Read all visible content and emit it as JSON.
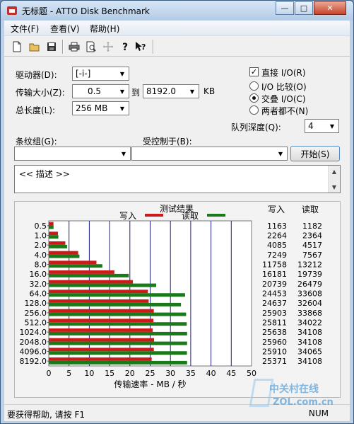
{
  "window": {
    "title": "无标题 - ATTO Disk Benchmark",
    "min_label": "—",
    "max_label": "□",
    "close_label": "✕"
  },
  "menu": [
    "文件(F)",
    "查看(V)",
    "帮助(H)"
  ],
  "toolbar_icons": [
    "new-file-icon",
    "open-folder-icon",
    "save-icon",
    "print-icon",
    "print-preview-icon",
    "move-icon",
    "help-icon",
    "context-help-icon"
  ],
  "settings": {
    "drive_label": "驱动器(D):",
    "drive_value": "[-i-]",
    "transfer_label": "传输大小(Z):",
    "transfer_from": "0.5",
    "to_label": "到",
    "transfer_to": "8192.0",
    "kb_label": "KB",
    "length_label": "总长度(L):",
    "length_value": "256 MB",
    "direct_io_label": "直接 I/O(R)",
    "direct_io_checked": true,
    "io_compare_label": "I/O 比较(O)",
    "overlap_io_label": "交叠 I/O(C)",
    "neither_label": "两者都不(N)",
    "queue_label": "队列深度(Q):",
    "queue_value": "4",
    "stripe_label": "条纹组(G):",
    "controlled_label": "受控制于(B):",
    "start_label": "开始(S)",
    "description": "<< 描述 >>"
  },
  "chart_data": {
    "type": "bar",
    "orientation": "horizontal",
    "title": "测试结果",
    "xlabel": "传输速率 - MB / 秒",
    "xlim": [
      0,
      50
    ],
    "xticks": [
      "0",
      "5",
      "10",
      "15",
      "20",
      "25",
      "30",
      "35",
      "40",
      "45",
      "50"
    ],
    "categories": [
      "0.5",
      "1.0",
      "2.0",
      "4.0",
      "8.0",
      "16.0",
      "32.0",
      "64.0",
      "128.0",
      "256.0",
      "512.0",
      "1024.0",
      "2048.0",
      "4096.0",
      "8192.0"
    ],
    "series": [
      {
        "name": "写入",
        "color": "#cc1a1a",
        "values": [
          1163,
          2264,
          4085,
          7249,
          11758,
          16181,
          20739,
          24453,
          24637,
          25903,
          25811,
          25638,
          25960,
          25910,
          25371
        ]
      },
      {
        "name": "读取",
        "color": "#1a7a1a",
        "values": [
          1182,
          2364,
          4517,
          7567,
          13212,
          19739,
          26479,
          33608,
          32604,
          33868,
          34022,
          34108,
          34108,
          34065,
          34108
        ]
      }
    ],
    "value_unit_divisor": 1000,
    "column_headers": [
      "写入",
      "读取"
    ]
  },
  "status": {
    "help_text": "要获得帮助, 请按 F1",
    "num_indicator": "NUM"
  },
  "watermark": {
    "text_cn": "中关村在线",
    "text_en": "ZOL.com.cn"
  }
}
